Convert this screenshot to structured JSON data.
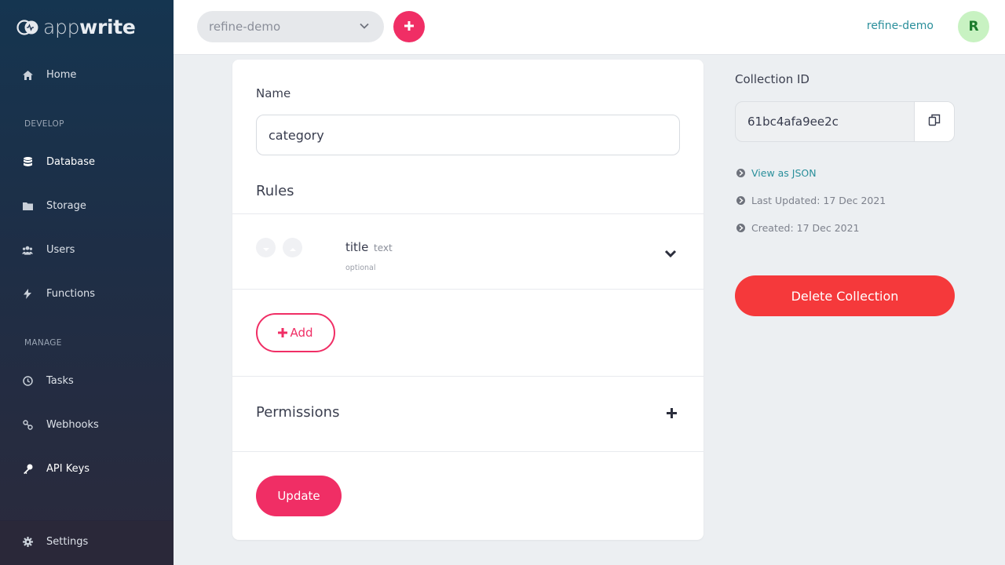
{
  "sidebar": {
    "logo": {
      "light": "app",
      "bold": "write"
    },
    "items": [
      {
        "label": "Home",
        "icon": "home-icon"
      },
      {
        "label": "Database",
        "icon": "database-icon"
      },
      {
        "label": "Storage",
        "icon": "folder-icon"
      },
      {
        "label": "Users",
        "icon": "users-icon"
      },
      {
        "label": "Functions",
        "icon": "bolt-icon"
      },
      {
        "label": "Tasks",
        "icon": "clock-icon"
      },
      {
        "label": "Webhooks",
        "icon": "link-icon"
      },
      {
        "label": "API Keys",
        "icon": "key-icon"
      },
      {
        "label": "Settings",
        "icon": "gear-icon"
      }
    ],
    "sections": {
      "develop": "DEVELOP",
      "manage": "MANAGE"
    }
  },
  "topbar": {
    "project": "refine-demo",
    "user_name": "refine-demo",
    "avatar_initial": "R"
  },
  "form": {
    "name_label": "Name",
    "name_value": "category",
    "rules_title": "Rules",
    "rule": {
      "title": "title",
      "type": "text",
      "optional": "optional"
    },
    "add_label": "Add",
    "permissions_title": "Permissions",
    "update_label": "Update"
  },
  "details": {
    "collection_id_label": "Collection ID",
    "collection_id": "61bc4afa9ee2c",
    "view_json": "View as JSON",
    "last_updated": "Last Updated: 17 Dec 2021",
    "created": "Created: 17 Dec 2021",
    "delete_label": "Delete Collection"
  },
  "colors": {
    "accent": "#f02e65",
    "danger": "#f5393b",
    "link": "#2a8f9b"
  }
}
